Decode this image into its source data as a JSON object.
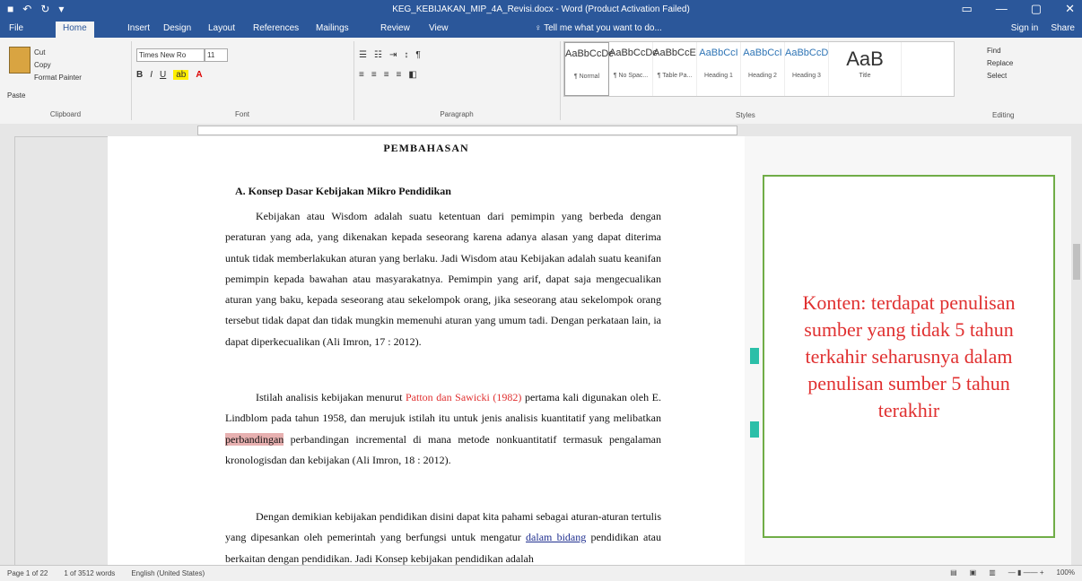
{
  "window": {
    "title": "KEG_KEBIJAKAN_MIP_4A_Revisi.docx - Word (Product Activation Failed)",
    "qat": [
      "■",
      "↶",
      "↻",
      "▾"
    ],
    "controls": [
      "▭",
      "—",
      "▢",
      "✕"
    ]
  },
  "tabs": {
    "items": [
      "File",
      "Home",
      "Insert",
      "Design",
      "Layout",
      "References",
      "Mailings",
      "Review",
      "View"
    ],
    "tell_me": "♀ Tell me what you want to do...",
    "sign_in": "Sign in",
    "share": "Share"
  },
  "ribbon": {
    "clipboard": {
      "paste": "Paste",
      "cut": "Cut",
      "copy": "Copy",
      "format_painter": "Format Painter",
      "label": "Clipboard"
    },
    "font": {
      "name": "Times New Ro",
      "size": "11",
      "label": "Font"
    },
    "paragraph": {
      "label": "Paragraph"
    },
    "styles": {
      "label": "Styles",
      "items": [
        {
          "preview": "AaBbCcDc",
          "name": "¶ Normal"
        },
        {
          "preview": "AaBbCcDc",
          "name": "¶ No Spac..."
        },
        {
          "preview": "AaBbCcE",
          "name": "¶ Table Pa..."
        },
        {
          "preview": "AaBbCcI",
          "name": "Heading 1"
        },
        {
          "preview": "AaBbCcI",
          "name": "Heading 2"
        },
        {
          "preview": "AaBbCcD",
          "name": "Heading 3"
        },
        {
          "preview": "AaB",
          "name": "Title"
        }
      ]
    },
    "editing": {
      "find": "Find",
      "replace": "Replace",
      "select": "Select",
      "label": "Editing"
    }
  },
  "document": {
    "heading": "PEMBAHASAN",
    "subheading": "A.  Konsep Dasar Kebijakan Mikro Pendidikan",
    "p1": "Kebijakan atau Wisdom adalah suatu ketentuan dari pemimpin yang berbeda dengan peraturan yang ada, yang dikenakan kepada seseorang karena adanya alasan yang dapat diterima untuk tidak memberlakukan aturan yang berlaku. Jadi Wisdom atau Kebijakan adalah suatu keanifan pemimpin kepada bawahan atau masyarakatnya. Pemimpin yang arif, dapat saja mengecualikan aturan yang baku, kepada seseorang atau sekelompok orang, jika seseorang atau sekelompok orang tersebut tidak dapat dan tidak mungkin memenuhi aturan yang umum tadi. Dengan perkataan lain, ia dapat diperkecualikan (Ali Imron, 17 : 2012).",
    "p2_a": "Istilah analisis kebijakan menurut ",
    "p2_cite": "Patton dan Sawicki (1982)",
    "p2_b": " pertama kali digunakan oleh E. Lindblom pada tahun 1958, dan merujuk istilah itu untuk jenis analisis kuantitatif yang melibatkan ",
    "p2_hl": "perbandingan",
    "p2_c": " perbandingan incremental di mana metode nonkuantitatif termasuk pengalaman kronologisdan dan kebijakan (Ali Imron, 18 : 2012).",
    "p3_a": "Dengan demikian kebijakan pendidikan disini dapat kita pahami sebagai aturan-aturan tertulis yang dipesankan oleh pemerintah yang berfungsi untuk mengatur ",
    "p3_ul": "dalam bidang",
    "p3_b": " pendidikan atau berkaitan dengan pendidikan. Jadi Konsep kebijakan pendidikan adalah"
  },
  "comment": {
    "text": "Konten: terdapat penulisan sumber yang tidak 5 tahun terkahir seharusnya dalam penulisan sumber 5 tahun terakhir"
  },
  "status": {
    "page": "Page 1 of 22",
    "words": "1 of 3512 words",
    "language": "English (United States)",
    "zoom": "100%"
  },
  "colors": {
    "word_blue": "#2b579a",
    "comment_border": "#70ad47",
    "comment_text": "#e03030"
  }
}
